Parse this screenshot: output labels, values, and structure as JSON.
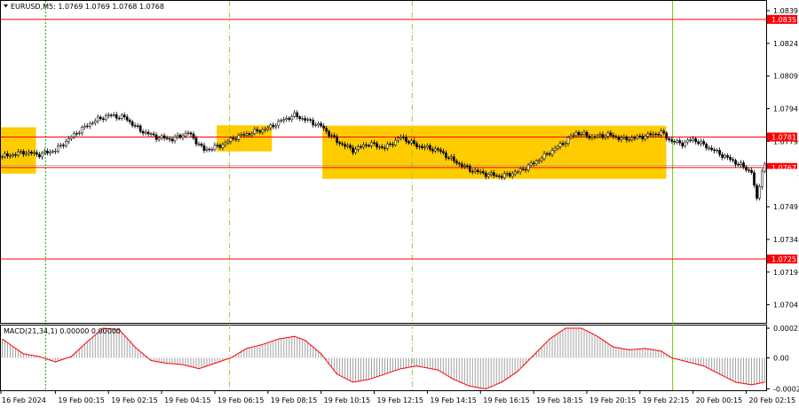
{
  "chart_data": {
    "type": "candlestick",
    "title": "EURUSD,M5: 1.0769 1.0769 1.0768 1.0768",
    "symbol": "EURUSD",
    "timeframe": "M5",
    "ohlc_readout": "1.0769 1.0769 1.0768 1.0768",
    "price_ylim": [
      1.06957,
      1.08435
    ],
    "price_ticks": [
      "1.0839",
      "1.0824",
      "1.0809",
      "1.0794",
      "1.0779",
      "1.0764",
      "1.0749",
      "1.0734",
      "1.0719",
      "1.0704"
    ],
    "x_ticks": [
      "16 Feb 2024",
      "19 Feb 00:15",
      "19 Feb 02:15",
      "19 Feb 04:15",
      "19 Feb 06:15",
      "19 Feb 08:15",
      "19 Feb 10:15",
      "19 Feb 12:15",
      "19 Feb 14:15",
      "19 Feb 16:15",
      "19 Feb 18:15",
      "19 Feb 20:15",
      "19 Feb 22:15",
      "20 Feb 00:15",
      "20 Feb 02:15"
    ],
    "levels": [
      {
        "price": 1.0835,
        "label": "1.0835",
        "color": "#ff0000"
      },
      {
        "price": 1.0781,
        "label": "1.0781",
        "color": "#ff0000"
      },
      {
        "price": 1.0767,
        "label": "1.0767",
        "color": "#ff0000"
      },
      {
        "price": 1.0725,
        "label": "1.0725",
        "color": "#ff0000"
      }
    ],
    "current_price": {
      "price": 1.0768,
      "label": "1.0768"
    },
    "zones": [
      {
        "from": 0.0,
        "to": 13.2,
        "low": 1.07642,
        "high": 1.07855
      },
      {
        "from": 81.2,
        "to": 102.0,
        "low": 1.07744,
        "high": 1.07864
      },
      {
        "from": 121.0,
        "to": 250.4,
        "low": 1.07618,
        "high": 1.07862
      }
    ],
    "vlines": [
      {
        "x": 16.8,
        "color": "#00aa00",
        "style": "dotted"
      },
      {
        "x": 86.0,
        "color": "#9acd32",
        "style": "dashdot"
      },
      {
        "x": 154.8,
        "color": "#9acd32",
        "style": "dashdot"
      },
      {
        "x": 252.8,
        "color": "#66cc00",
        "style": "solid"
      }
    ],
    "x_count": 288,
    "price_path": [
      [
        0,
        1.0772
      ],
      [
        8,
        1.0774
      ],
      [
        14,
        1.0773
      ],
      [
        20,
        1.0775
      ],
      [
        28,
        1.0783
      ],
      [
        34,
        1.0788
      ],
      [
        40,
        1.0791
      ],
      [
        46,
        1.079
      ],
      [
        52,
        1.0784
      ],
      [
        58,
        1.0781
      ],
      [
        64,
        1.078
      ],
      [
        70,
        1.0783
      ],
      [
        76,
        1.0775
      ],
      [
        82,
        1.0777
      ],
      [
        88,
        1.0781
      ],
      [
        94,
        1.0783
      ],
      [
        100,
        1.0785
      ],
      [
        106,
        1.0789
      ],
      [
        110,
        1.0791
      ],
      [
        114,
        1.0789
      ],
      [
        120,
        1.0786
      ],
      [
        126,
        1.0779
      ],
      [
        132,
        1.0775
      ],
      [
        138,
        1.0778
      ],
      [
        144,
        1.0776
      ],
      [
        150,
        1.0781
      ],
      [
        156,
        1.0777
      ],
      [
        164,
        1.0775
      ],
      [
        170,
        1.077
      ],
      [
        176,
        1.0766
      ],
      [
        182,
        1.0764
      ],
      [
        188,
        1.0763
      ],
      [
        194,
        1.0765
      ],
      [
        200,
        1.0769
      ],
      [
        206,
        1.0774
      ],
      [
        212,
        1.0779
      ],
      [
        216,
        1.0783
      ],
      [
        222,
        1.0781
      ],
      [
        228,
        1.0782
      ],
      [
        234,
        1.078
      ],
      [
        240,
        1.0781
      ],
      [
        248,
        1.0783
      ],
      [
        252,
        1.0779
      ],
      [
        256,
        1.0778
      ],
      [
        260,
        1.078
      ],
      [
        266,
        1.0776
      ],
      [
        272,
        1.0772
      ],
      [
        278,
        1.0768
      ],
      [
        282,
        1.0765
      ],
      [
        284,
        1.0752
      ],
      [
        286,
        1.0766
      ],
      [
        287,
        1.0768
      ]
    ],
    "macd": {
      "label": "MACD(21,34,1) 0.00000 0.00000",
      "params": [
        21,
        34,
        1
      ],
      "ylim": [
        -0.00024,
        0.00024
      ],
      "ticks": [
        "0.00022",
        "0.00",
        "-0.00023"
      ],
      "path": [
        [
          0,
          0.00014
        ],
        [
          8,
          3e-05
        ],
        [
          14,
          1e-05
        ],
        [
          20,
          -3e-05
        ],
        [
          26,
          1e-05
        ],
        [
          32,
          0.00012
        ],
        [
          38,
          0.00022
        ],
        [
          44,
          0.00021
        ],
        [
          50,
          8e-05
        ],
        [
          56,
          -2e-05
        ],
        [
          62,
          -4e-05
        ],
        [
          68,
          -5e-05
        ],
        [
          74,
          -8e-05
        ],
        [
          80,
          -4e-05
        ],
        [
          86,
          0.0
        ],
        [
          92,
          7e-05
        ],
        [
          98,
          0.0001
        ],
        [
          104,
          0.00014
        ],
        [
          110,
          0.00016
        ],
        [
          114,
          0.00013
        ],
        [
          120,
          3e-05
        ],
        [
          126,
          -0.00012
        ],
        [
          132,
          -0.00018
        ],
        [
          138,
          -0.00016
        ],
        [
          144,
          -0.00012
        ],
        [
          150,
          -8e-05
        ],
        [
          156,
          -6e-05
        ],
        [
          164,
          -9e-05
        ],
        [
          170,
          -0.00016
        ],
        [
          176,
          -0.00021
        ],
        [
          182,
          -0.00023
        ],
        [
          188,
          -0.00018
        ],
        [
          194,
          -0.0001
        ],
        [
          200,
          2e-05
        ],
        [
          206,
          0.00014
        ],
        [
          212,
          0.00022
        ],
        [
          218,
          0.00022
        ],
        [
          224,
          0.00016
        ],
        [
          230,
          8e-05
        ],
        [
          236,
          6e-05
        ],
        [
          242,
          7e-05
        ],
        [
          248,
          5e-05
        ],
        [
          252,
          0.0
        ],
        [
          258,
          -3e-05
        ],
        [
          264,
          -6e-05
        ],
        [
          270,
          -0.00012
        ],
        [
          276,
          -0.00018
        ],
        [
          282,
          -0.0002
        ],
        [
          287,
          -0.00018
        ]
      ]
    },
    "colors": {
      "zone": "#ffcc00",
      "level": "#ff0000",
      "candle": "#000000",
      "macd_hist": "#a0a0a0",
      "macd_signal": "#ff0000"
    }
  }
}
